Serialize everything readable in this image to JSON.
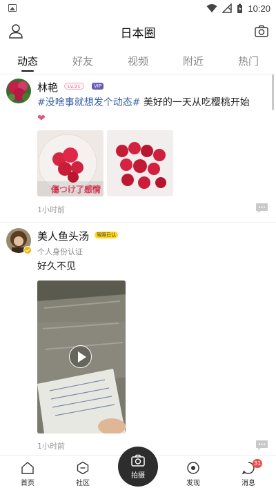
{
  "status_bar": {
    "time": "10:20"
  },
  "header": {
    "title": "日本圈"
  },
  "tabs": [
    {
      "label": "动态",
      "active": true
    },
    {
      "label": "好友"
    },
    {
      "label": "视频"
    },
    {
      "label": "附近"
    },
    {
      "label": "热门"
    }
  ],
  "posts": [
    {
      "username": "林艳",
      "level": "Lv.21",
      "vip_badge": "VIP",
      "hashtag": "#没啥事就想发个动态#",
      "text": " 美好的一天从吃樱桃开始",
      "emoji": "❤",
      "photo_caption": "傷つけ了感情",
      "time": "1小时前"
    },
    {
      "username": "美人鱼头汤",
      "badge": "驾照已认",
      "subtitle": "个人身份认证",
      "text": "好久不见",
      "time": "1小时前"
    }
  ],
  "bottom_nav": {
    "items": [
      {
        "label": "首页",
        "icon": "home-icon"
      },
      {
        "label": "社区",
        "icon": "community-icon"
      },
      {
        "label": "拍摄",
        "icon": "camera-icon"
      },
      {
        "label": "发现",
        "icon": "discover-icon"
      },
      {
        "label": "消息",
        "icon": "message-icon",
        "badge": "31"
      }
    ]
  },
  "colors": {
    "hashtag": "#3d5fa8",
    "fab": "#2d2d2d",
    "badge": "#f04e4e",
    "vip": "#6a5bb5"
  }
}
